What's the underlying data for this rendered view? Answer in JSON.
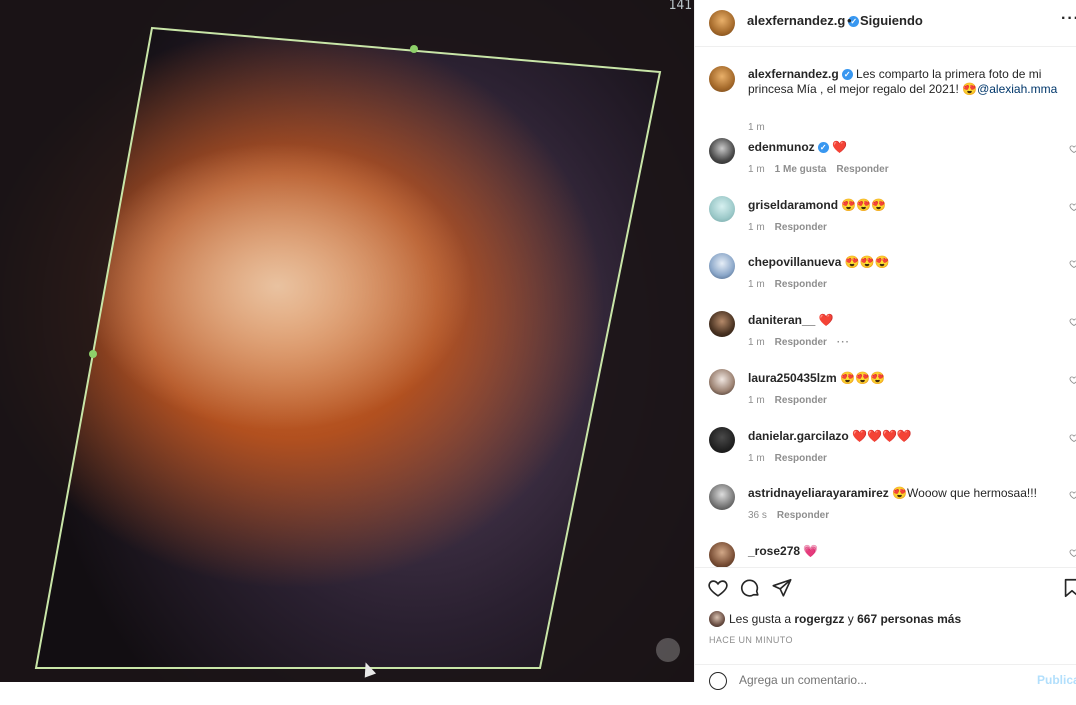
{
  "photo": {
    "label": "141"
  },
  "header": {
    "username": "alexfernandez.g",
    "separator": "•",
    "follow_label": "Siguiendo",
    "more": "···"
  },
  "caption": {
    "username": "alexfernandez.g",
    "text": " Les comparto la primera foto de mi princesa Mía , el mejor regalo del 2021! 😍",
    "mention": "@alexiah.mma",
    "time": "1 m"
  },
  "comments": [
    {
      "user": "edenmunoz",
      "verified": true,
      "text": "❤️",
      "time": "1 m",
      "likes": "1 Me gusta",
      "reply": "Responder",
      "more": ""
    },
    {
      "user": "griseldaramond",
      "verified": false,
      "text": "😍😍😍",
      "time": "1 m",
      "likes": "",
      "reply": "Responder",
      "more": ""
    },
    {
      "user": "chepovillanueva",
      "verified": false,
      "text": "😍😍😍",
      "time": "1 m",
      "likes": "",
      "reply": "Responder",
      "more": ""
    },
    {
      "user": "daniteran__",
      "verified": false,
      "text": "❤️",
      "time": "1 m",
      "likes": "",
      "reply": "Responder",
      "more": "···"
    },
    {
      "user": "laura250435lzm",
      "verified": false,
      "text": "😍😍😍",
      "time": "1 m",
      "likes": "",
      "reply": "Responder",
      "more": ""
    },
    {
      "user": "danielar.garcilazo",
      "verified": false,
      "text": "❤️❤️❤️❤️",
      "time": "1 m",
      "likes": "",
      "reply": "Responder",
      "more": ""
    },
    {
      "user": "astridnayeliarayaramirez",
      "verified": false,
      "text": "😍Wooow que hermosaa!!!",
      "time": "36 s",
      "likes": "",
      "reply": "Responder",
      "more": ""
    },
    {
      "user": "_rose278",
      "verified": false,
      "text": "💗",
      "time": "",
      "likes": "",
      "reply": "",
      "more": ""
    }
  ],
  "likes": {
    "prefix": "Les gusta a",
    "user": "rogergzz",
    "conj": "y",
    "others": "667 personas más"
  },
  "timestamp": "HACE UN MINUTO",
  "add_comment": {
    "placeholder": "Agrega un comentario...",
    "publish": "Publicar"
  },
  "colors": {
    "link": "#00376b",
    "verified": "#3897f0",
    "secondary": "#8e8e8e",
    "publish_disabled": "#b2dffc"
  }
}
